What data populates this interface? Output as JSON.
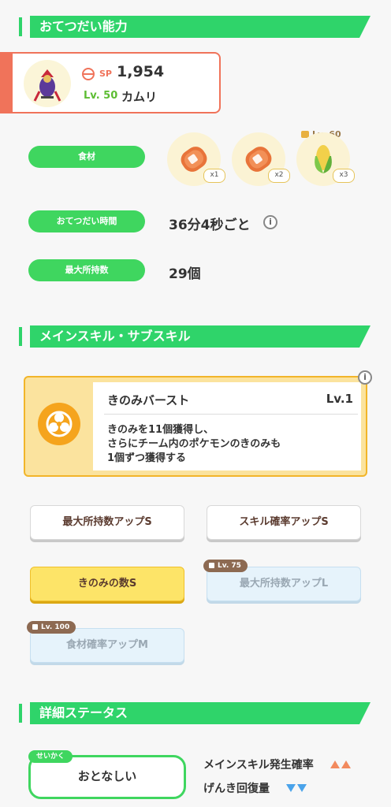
{
  "sections": {
    "help_ability": "おてつだい能力",
    "skills": "メインスキル・サブスキル",
    "details": "詳細ステータス"
  },
  "pokemon": {
    "sp_label": "SP",
    "sp_value": "1,954",
    "level": "Lv. 50",
    "name": "カムリ"
  },
  "help": {
    "ingredients_label": "食材",
    "ingredients": [
      {
        "icon": "sausage-icon",
        "qty": "x1"
      },
      {
        "icon": "sausage-icon",
        "qty": "x2"
      },
      {
        "icon": "corn-icon",
        "qty": "x3",
        "lock": "Lv. 60"
      }
    ],
    "help_time_label": "おてつだい時間",
    "help_time_value": "36分4秒ごと",
    "max_carry_label": "最大所持数",
    "max_carry_value": "29個"
  },
  "main_skill": {
    "name": "きのみバースト",
    "level": "Lv.1",
    "description": "きのみを11個獲得し、\nさらにチーム内のポケモンのきのみも\n1個ずつ獲得する",
    "icon": "berry-burst-icon"
  },
  "sub_skills": [
    {
      "label": "最大所持数アップS",
      "state": "normal"
    },
    {
      "label": "スキル確率アップS",
      "state": "normal"
    },
    {
      "label": "きのみの数S",
      "state": "gold"
    },
    {
      "label": "最大所持数アップL",
      "state": "locked",
      "lock": "Lv. 75"
    },
    {
      "label": "食材確率アップM",
      "state": "locked",
      "lock": "Lv. 100"
    }
  ],
  "nature": {
    "tag": "せいかく",
    "value": "おとなしい",
    "up_label": "メインスキル発生確率",
    "down_label": "げんき回復量"
  },
  "info_glyph": "i",
  "colors": {
    "green": "#3fd65f",
    "accent": "#f0735a",
    "gold": "#f2b52a",
    "up": "#f28a5e",
    "down": "#4aa3ea"
  }
}
